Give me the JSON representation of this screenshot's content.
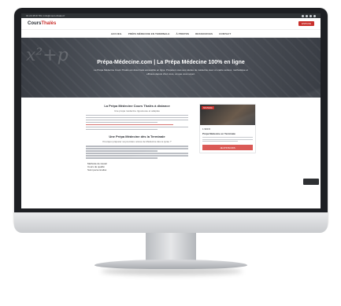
{
  "topbar": {
    "contact": "01 23 45 67 89 | info@cours-thales.fr"
  },
  "header": {
    "logo_main": "Cours",
    "logo_accent": "Thalès",
    "cta": "ESPACE"
  },
  "nav": {
    "items": [
      "ACCUEIL",
      "PRÉPA MÉDECINE EN TERMINALE",
      "À PROPOS",
      "RESSOURCES",
      "CONTACT"
    ]
  },
  "hero": {
    "title": "Prépa-Médecine.com | La Prépa Médecine 100% en ligne",
    "subtitle": "La Prépa Médecine Cours Thalès est désormais accessible en ligne. Préparez-vous aux études de médecine avec un cadre sérieux, méthodique et efficace depuis chez vous, où que vous soyez."
  },
  "article": {
    "heading1": "La Prépa Médecine Cours Thalès à distance",
    "lead1": "Une prépa médecine rigoureuse et adaptée",
    "heading2": "Une Prépa Médecine dès la Terminale",
    "lead2": "Pourquoi préparer sa première année de Médecine dès le lycée ?",
    "bullets": [
      "Méthode de travail",
      "Cours de qualité",
      "Suivi personnalisé"
    ]
  },
  "card": {
    "tag": "NOUVEAU",
    "price": "1 990 €",
    "title": "Prépa Médecine en Terminale",
    "button": "JE M'INSCRIS"
  }
}
